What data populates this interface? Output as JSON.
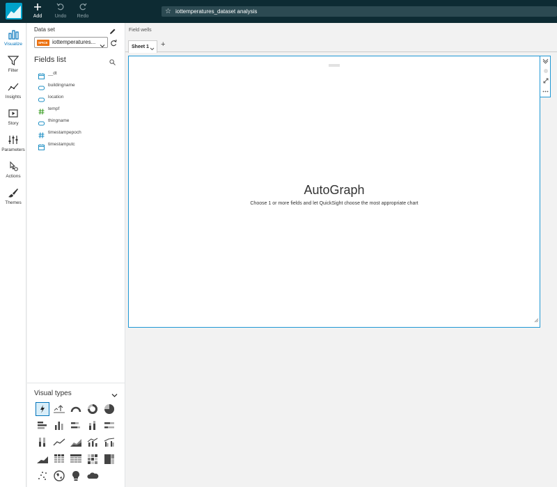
{
  "topbar": {
    "add_label": "Add",
    "undo_label": "Undo",
    "redo_label": "Redo",
    "analysis_title": "iottemperatures_dataset analysis"
  },
  "nav": {
    "items": [
      {
        "label": "Visualize",
        "icon": "bar-chart-icon",
        "active": true
      },
      {
        "label": "Filter",
        "icon": "funnel-icon"
      },
      {
        "label": "Insights",
        "icon": "trend-line-icon"
      },
      {
        "label": "Story",
        "icon": "play-screen-icon"
      },
      {
        "label": "Parameters",
        "icon": "sliders-icon"
      },
      {
        "label": "Actions",
        "icon": "pointer-gear-icon"
      },
      {
        "label": "Themes",
        "icon": "brush-icon"
      }
    ]
  },
  "dataset": {
    "label": "Data set",
    "badge": "SPICE",
    "name": "iottemperatures..."
  },
  "fields_list": {
    "title": "Fields list",
    "fields": [
      {
        "name": "__dt",
        "type": "date"
      },
      {
        "name": "buildingname",
        "type": "string"
      },
      {
        "name": "location",
        "type": "string"
      },
      {
        "name": "tempf",
        "type": "number"
      },
      {
        "name": "thingname",
        "type": "string"
      },
      {
        "name": "timestampepoch",
        "type": "number"
      },
      {
        "name": "timestamputc",
        "type": "date"
      }
    ]
  },
  "visual_types": {
    "title": "Visual types"
  },
  "field_wells": {
    "label": "Field wells"
  },
  "sheets": {
    "tabs": [
      "Sheet 1"
    ],
    "add_label": "+"
  },
  "autograph": {
    "title": "AutoGraph",
    "subtitle": "Choose 1 or more fields and let QuickSight choose the most appropriate chart"
  },
  "colors": {
    "topbar": "#0d2b33",
    "accent": "#0073bb",
    "visual_border": "#1e97d4",
    "spice_badge": "#ec7211",
    "field_icon": "#1e8fc4",
    "number_icon": "#3a9d23"
  }
}
